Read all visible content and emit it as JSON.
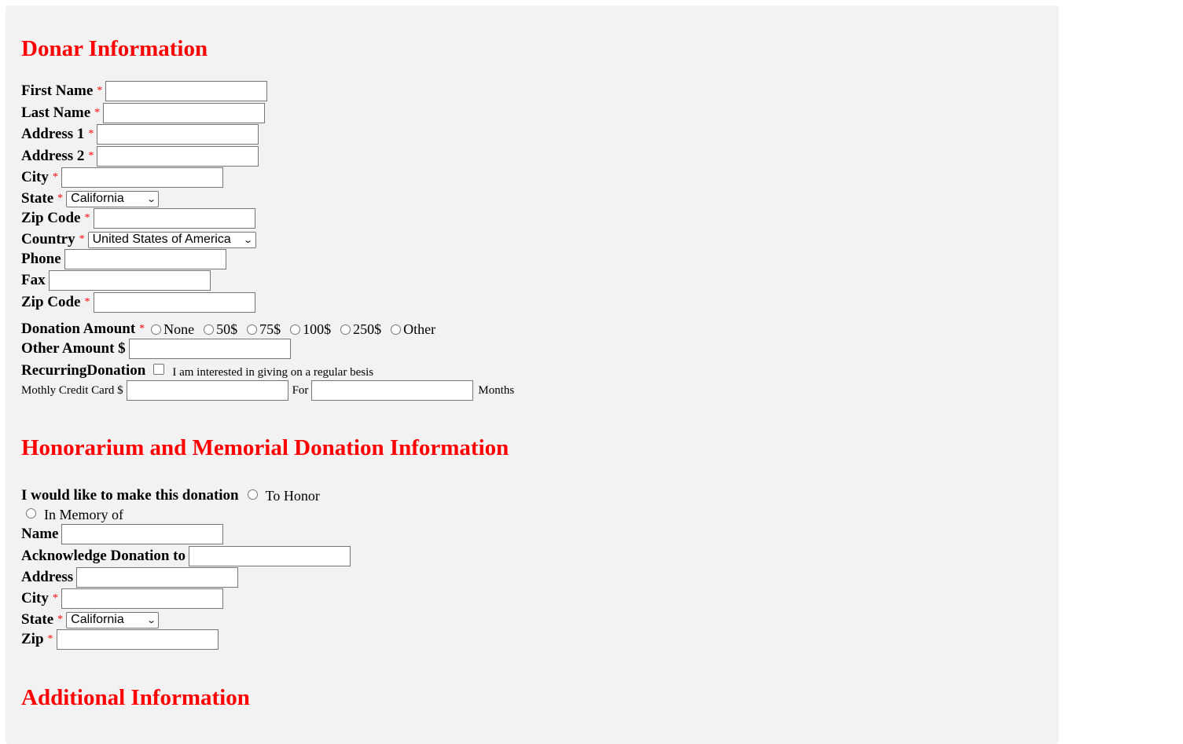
{
  "donor": {
    "heading": "Donar Information",
    "first_name": "First Name",
    "last_name": "Last Name",
    "address1": "Address 1",
    "address2": "Address 2",
    "city": "City",
    "state": "State",
    "state_value": "California",
    "zip": "Zip Code",
    "country": "Country",
    "country_value": "United States of America",
    "phone": "Phone",
    "fax": "Fax",
    "zip2": "Zip Code",
    "donation_amount": "Donation Amount",
    "amount_options": [
      "None",
      "50$",
      "75$",
      "100$",
      "250$",
      "Other"
    ],
    "other_amount": "Other Amount $",
    "recurring": "RecurringDonation",
    "recurring_text": "I am interested in giving on a regular besis",
    "monthly_card": "Mothly Credit Card $",
    "for": "For",
    "months": "Months",
    "required_mark": "*"
  },
  "honor": {
    "heading": "Honorarium and Memorial Donation Information",
    "make_donation": "I would like to make this donation",
    "to_honor": "To Honor",
    "in_memory": "In Memory of",
    "name": "Name",
    "acknowledge": "Acknowledge Donation to",
    "address": "Address",
    "city": "City",
    "state": "State",
    "state_value": "California",
    "zip": "Zip"
  },
  "additional": {
    "heading": "Additional Information"
  }
}
